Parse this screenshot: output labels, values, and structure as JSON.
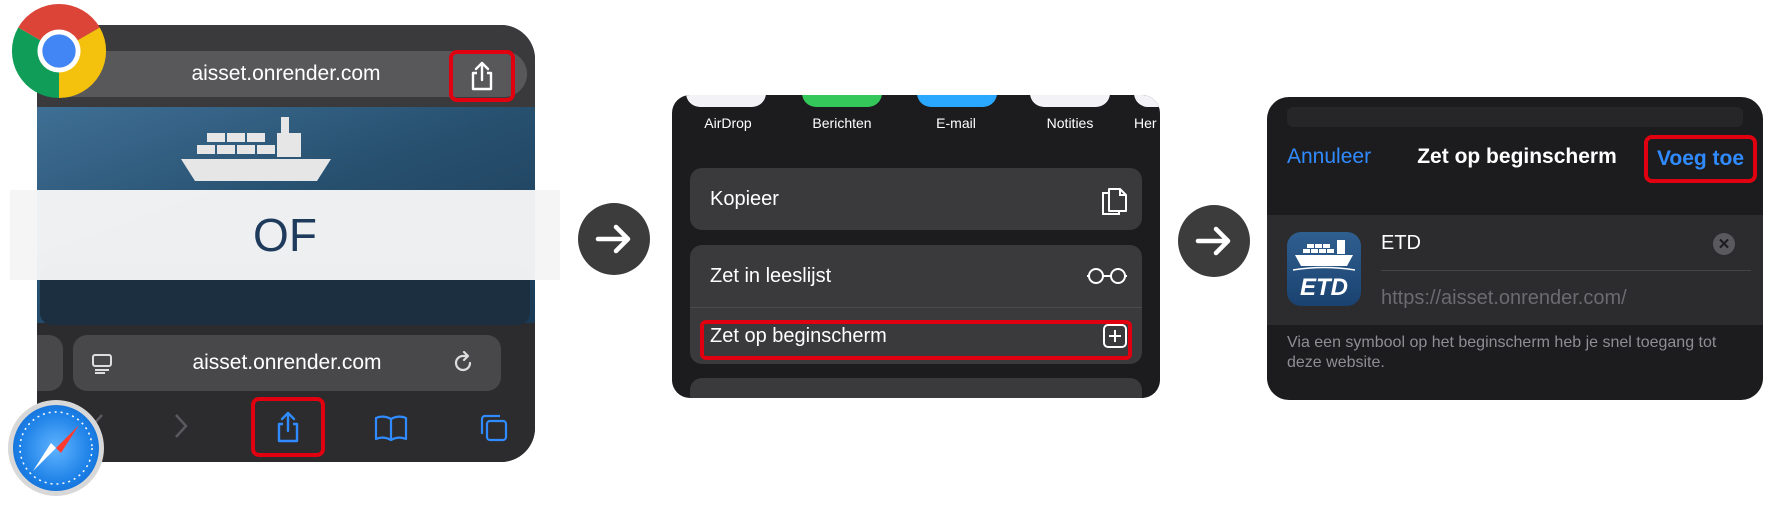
{
  "panel1": {
    "top_url": "aisset.onrender.com",
    "bottom_url": "aisset.onrender.com",
    "or_label": "OF"
  },
  "panel2": {
    "share_targets": [
      "AirDrop",
      "Berichten",
      "E-mail",
      "Notities",
      "Her"
    ],
    "share_target_colors": [
      "#f2f2f7",
      "#34c759",
      "#2aa8ff",
      "#f2f2f7",
      "#f2f2f7"
    ],
    "actions": [
      "Kopieer",
      "Zet in leeslijst",
      "Zet op beginscherm"
    ]
  },
  "panel3": {
    "cancel_label": "Annuleer",
    "title": "Zet op beginscherm",
    "add_label": "Voeg toe",
    "app_name": "ETD",
    "app_url": "https://aisset.onrender.com/",
    "icon_text": "ETD",
    "footer_text": "Via een symbool op het beginscherm heb je snel toegang tot deze website."
  },
  "colors": {
    "highlight": "#e00010",
    "ios_blue": "#2f8bff",
    "of_text": "#1f3b5c",
    "arrow_bg": "#3c3c3c"
  },
  "icons": [
    "share-icon",
    "reader-icon",
    "reload-icon",
    "back-icon",
    "forward-icon",
    "bookmarks-icon",
    "tabs-icon",
    "copy-icon",
    "glasses-icon",
    "add-square-icon",
    "clear-icon",
    "chrome-logo-icon",
    "safari-logo-icon",
    "arrow-right-icon"
  ]
}
